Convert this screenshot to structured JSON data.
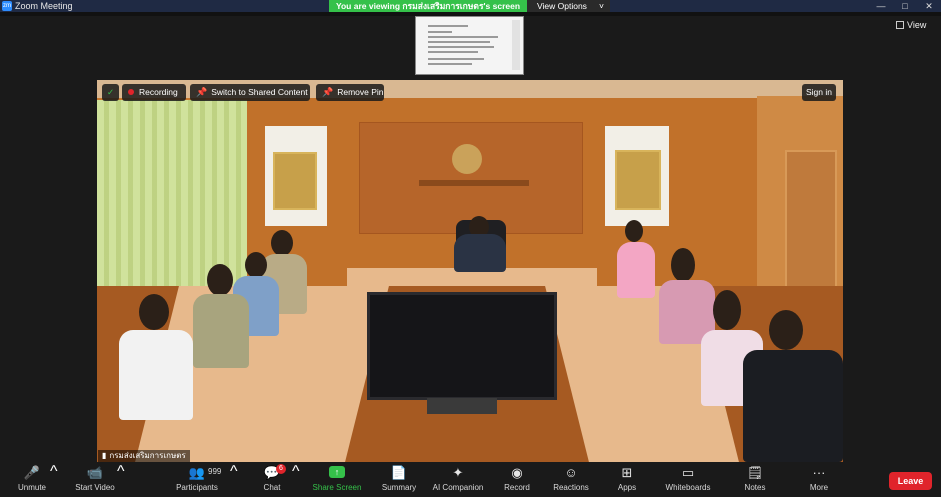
{
  "window": {
    "app_title": "Zoom Meeting",
    "app_logo_text": "zm",
    "banner_text": "You are viewing กรมส่งเสริมการเกษตร's screen",
    "view_options_label": "View Options",
    "view_options_chevron": "˅",
    "controls": [
      "—",
      "□",
      "✕"
    ]
  },
  "top_right": {
    "view_label": "View"
  },
  "overlays": {
    "shield_glyph": "✓",
    "recording_label": "Recording",
    "switch_label": "Switch to Shared Content",
    "remove_pin_label": "Remove Pin",
    "pin_glyph": "📌",
    "sign_in_label": "Sign in"
  },
  "participant_name": "กรมส่งเสริมการเกษตร",
  "signal_glyph": "▮",
  "toolbar": {
    "unmute": {
      "label": "Unmute",
      "icon": "microphone-muted-icon",
      "glyph": "🎤"
    },
    "start_video": {
      "label": "Start Video",
      "icon": "video-off-icon",
      "glyph": "📹"
    },
    "participants": {
      "label": "Participants",
      "icon": "participants-icon",
      "glyph": "👥",
      "count": "999"
    },
    "chat": {
      "label": "Chat",
      "icon": "chat-icon",
      "glyph": "💬",
      "badge": "6"
    },
    "share_screen": {
      "label": "Share Screen",
      "icon": "share-screen-icon",
      "glyph": "↑"
    },
    "summary": {
      "label": "Summary",
      "icon": "summary-icon",
      "glyph": "📄"
    },
    "ai_companion": {
      "label": "AI Companion",
      "icon": "ai-companion-icon",
      "glyph": "✦"
    },
    "record": {
      "label": "Record",
      "icon": "record-icon",
      "glyph": "◉"
    },
    "reactions": {
      "label": "Reactions",
      "icon": "reactions-icon",
      "glyph": "☺"
    },
    "apps": {
      "label": "Apps",
      "icon": "apps-icon",
      "glyph": "⊞"
    },
    "whiteboards": {
      "label": "Whiteboards",
      "icon": "whiteboards-icon",
      "glyph": "▭"
    },
    "notes": {
      "label": "Notes",
      "icon": "notes-icon",
      "glyph": "🗒"
    },
    "more": {
      "label": "More",
      "icon": "more-icon",
      "glyph": "···"
    },
    "caret": "^",
    "leave_label": "Leave"
  },
  "colors": {
    "green": "#35c14a",
    "red": "#e0242b",
    "zoom_blue": "#2d8cff"
  }
}
